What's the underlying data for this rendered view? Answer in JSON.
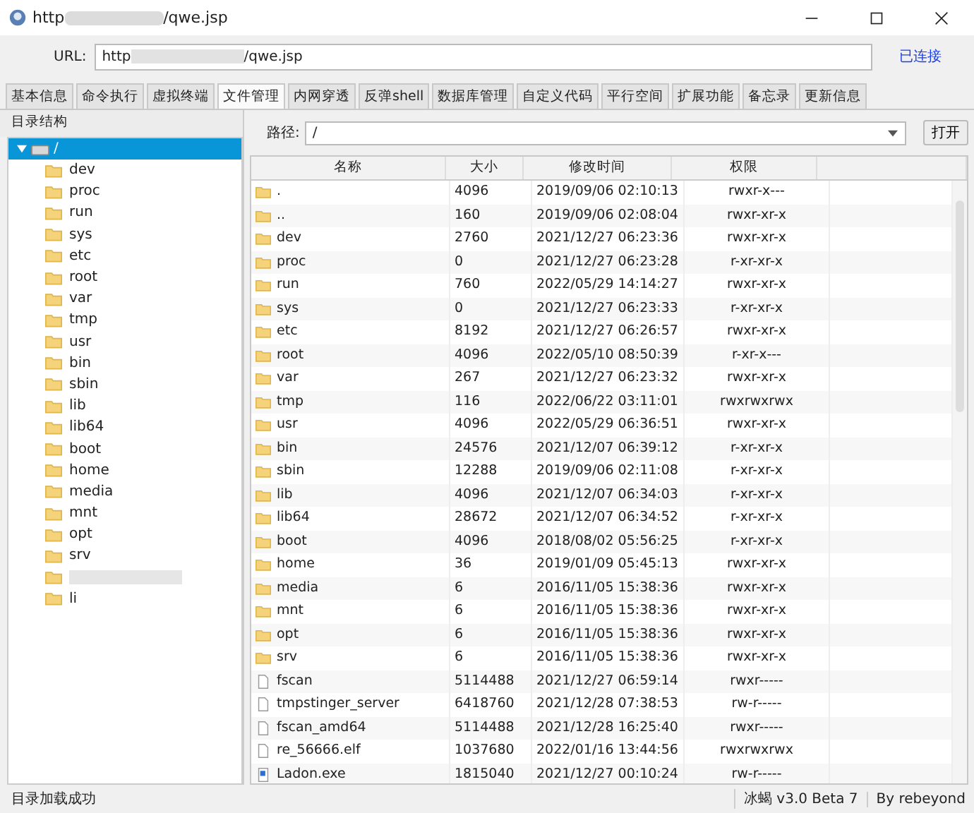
{
  "window": {
    "title_start": "http",
    "title_end": "/qwe.jsp"
  },
  "url_bar": {
    "label": "URL:",
    "value_start": "http",
    "value_end": "/qwe.jsp",
    "status": "已连接"
  },
  "tabs": [
    {
      "label": "基本信息",
      "selected": false
    },
    {
      "label": "命令执行",
      "selected": false
    },
    {
      "label": "虚拟终端",
      "selected": false
    },
    {
      "label": "文件管理",
      "selected": true
    },
    {
      "label": "内网穿透",
      "selected": false
    },
    {
      "label": "反弹shell",
      "selected": false
    },
    {
      "label": "数据库管理",
      "selected": false
    },
    {
      "label": "自定义代码",
      "selected": false
    },
    {
      "label": "平行空间",
      "selected": false
    },
    {
      "label": "扩展功能",
      "selected": false
    },
    {
      "label": "备忘录",
      "selected": false
    },
    {
      "label": "更新信息",
      "selected": false
    }
  ],
  "tree": {
    "title": "目录结构",
    "root": {
      "label": "/",
      "expanded": true,
      "selected": true,
      "children": [
        {
          "label": "dev"
        },
        {
          "label": "proc"
        },
        {
          "label": "run"
        },
        {
          "label": "sys"
        },
        {
          "label": "etc"
        },
        {
          "label": "root"
        },
        {
          "label": "var"
        },
        {
          "label": "tmp"
        },
        {
          "label": "usr"
        },
        {
          "label": "bin"
        },
        {
          "label": "sbin"
        },
        {
          "label": "lib"
        },
        {
          "label": "lib64"
        },
        {
          "label": "boot"
        },
        {
          "label": "home"
        },
        {
          "label": "media"
        },
        {
          "label": "mnt"
        },
        {
          "label": "opt"
        },
        {
          "label": "srv"
        },
        {
          "kind": "redacted"
        },
        {
          "label": "li"
        }
      ]
    }
  },
  "path_bar": {
    "label": "路径:",
    "value": "/",
    "button": "打开"
  },
  "table": {
    "columns": [
      "名称",
      "大小",
      "修改时间",
      "权限"
    ],
    "rows": [
      {
        "kind": "folder",
        "name": ".",
        "size": "4096",
        "modified": "2019/09/06 02:10:13",
        "perm": "rwxr-x---"
      },
      {
        "kind": "folder",
        "name": "..",
        "size": "160",
        "modified": "2019/09/06 02:08:04",
        "perm": "rwxr-xr-x"
      },
      {
        "kind": "folder",
        "name": "dev",
        "size": "2760",
        "modified": "2021/12/27 06:23:36",
        "perm": "rwxr-xr-x"
      },
      {
        "kind": "folder",
        "name": "proc",
        "size": "0",
        "modified": "2021/12/27 06:23:28",
        "perm": "r-xr-xr-x"
      },
      {
        "kind": "folder",
        "name": "run",
        "size": "760",
        "modified": "2022/05/29 14:14:27",
        "perm": "rwxr-xr-x"
      },
      {
        "kind": "folder",
        "name": "sys",
        "size": "0",
        "modified": "2021/12/27 06:23:33",
        "perm": "r-xr-xr-x"
      },
      {
        "kind": "folder",
        "name": "etc",
        "size": "8192",
        "modified": "2021/12/27 06:26:57",
        "perm": "rwxr-xr-x"
      },
      {
        "kind": "folder",
        "name": "root",
        "size": "4096",
        "modified": "2022/05/10 08:50:39",
        "perm": "r-xr-x---"
      },
      {
        "kind": "folder",
        "name": "var",
        "size": "267",
        "modified": "2021/12/27 06:23:32",
        "perm": "rwxr-xr-x"
      },
      {
        "kind": "folder",
        "name": "tmp",
        "size": "116",
        "modified": "2022/06/22 03:11:01",
        "perm": "rwxrwxrwx"
      },
      {
        "kind": "folder",
        "name": "usr",
        "size": "4096",
        "modified": "2022/05/29 06:36:51",
        "perm": "rwxr-xr-x"
      },
      {
        "kind": "folder",
        "name": "bin",
        "size": "24576",
        "modified": "2021/12/07 06:39:12",
        "perm": "r-xr-xr-x"
      },
      {
        "kind": "folder",
        "name": "sbin",
        "size": "12288",
        "modified": "2019/09/06 02:11:08",
        "perm": "r-xr-xr-x"
      },
      {
        "kind": "folder",
        "name": "lib",
        "size": "4096",
        "modified": "2021/12/07 06:34:03",
        "perm": "r-xr-xr-x"
      },
      {
        "kind": "folder",
        "name": "lib64",
        "size": "28672",
        "modified": "2021/12/07 06:34:52",
        "perm": "r-xr-xr-x"
      },
      {
        "kind": "folder",
        "name": "boot",
        "size": "4096",
        "modified": "2018/08/02 05:56:25",
        "perm": "r-xr-xr-x"
      },
      {
        "kind": "folder",
        "name": "home",
        "size": "36",
        "modified": "2019/01/09 05:45:13",
        "perm": "rwxr-xr-x"
      },
      {
        "kind": "folder",
        "name": "media",
        "size": "6",
        "modified": "2016/11/05 15:38:36",
        "perm": "rwxr-xr-x"
      },
      {
        "kind": "folder",
        "name": "mnt",
        "size": "6",
        "modified": "2016/11/05 15:38:36",
        "perm": "rwxr-xr-x"
      },
      {
        "kind": "folder",
        "name": "opt",
        "size": "6",
        "modified": "2016/11/05 15:38:36",
        "perm": "rwxr-xr-x"
      },
      {
        "kind": "folder",
        "name": "srv",
        "size": "6",
        "modified": "2016/11/05 15:38:36",
        "perm": "rwxr-xr-x"
      },
      {
        "kind": "file",
        "name": "fscan",
        "size": "5114488",
        "modified": "2021/12/27 06:59:14",
        "perm": "rwxr-----"
      },
      {
        "kind": "file",
        "name": "tmpstinger_server",
        "size": "6418760",
        "modified": "2021/12/28 07:38:53",
        "perm": "rw-r-----"
      },
      {
        "kind": "file",
        "name": "fscan_amd64",
        "size": "5114488",
        "modified": "2021/12/28 16:25:40",
        "perm": "rwxr-----"
      },
      {
        "kind": "file",
        "name": "re_56666.elf",
        "size": "1037680",
        "modified": "2022/01/16 13:44:56",
        "perm": "rwxrwxrwx"
      },
      {
        "kind": "exe",
        "name": "Ladon.exe",
        "size": "1815040",
        "modified": "2021/12/27 00:10:24",
        "perm": "rw-r-----"
      }
    ]
  },
  "status_bar": {
    "message": "目录加载成功",
    "version": "冰蝎 v3.0 Beta 7",
    "author": "By rebeyond"
  }
}
